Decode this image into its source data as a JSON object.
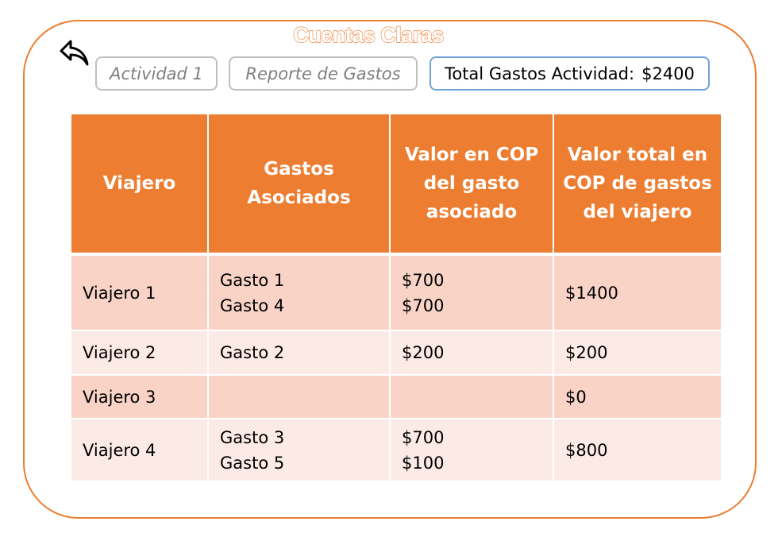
{
  "app": {
    "title": "Cuentas Claras",
    "brand_color": "#ED7D31"
  },
  "nav": {
    "back_icon": "back-arrow-icon",
    "activity_label": "Actividad 1",
    "report_label": "Reporte de Gastos",
    "total_label": "Total Gastos Actividad:",
    "total_value": "$2400"
  },
  "table": {
    "headers": [
      "Viajero",
      "Gastos Asociados",
      "Valor en COP del gasto asociado",
      "Valor total en COP de gastos del viajero"
    ],
    "rows": [
      {
        "traveler": "Viajero 1",
        "expenses": [
          "Gasto 1",
          "Gasto 4"
        ],
        "values": [
          "$700",
          "$700"
        ],
        "total": "$1400"
      },
      {
        "traveler": "Viajero 2",
        "expenses": [
          "Gasto 2"
        ],
        "values": [
          "$200"
        ],
        "total": "$200"
      },
      {
        "traveler": "Viajero 3",
        "expenses": [],
        "values": [],
        "total": "$0"
      },
      {
        "traveler": "Viajero 4",
        "expenses": [
          "Gasto 3",
          "Gasto 5"
        ],
        "values": [
          "$700",
          "$100"
        ],
        "total": "$800"
      }
    ],
    "header_color": "#ED7D31",
    "row_dark_color": "#F8D3C6",
    "row_light_color": "#FBEAE5"
  }
}
